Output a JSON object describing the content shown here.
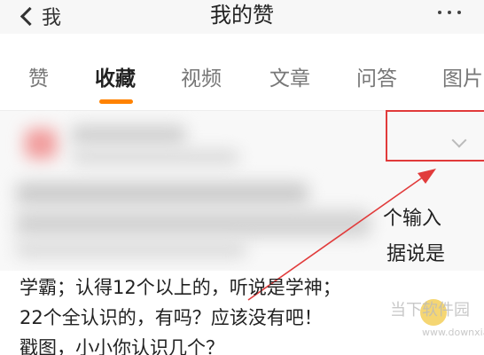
{
  "header": {
    "back_label": "我",
    "title": "我的赞"
  },
  "tabs": [
    {
      "label": "赞",
      "active": false
    },
    {
      "label": "收藏",
      "active": true
    },
    {
      "label": "视频",
      "active": false
    },
    {
      "label": "文章",
      "active": false
    },
    {
      "label": "问答",
      "active": false
    },
    {
      "label": "图片",
      "active": false
    }
  ],
  "annotation": {
    "line1": "个输入",
    "line2": "据说是"
  },
  "post": {
    "line1": "学霸；认得12个以上的，听说是学神；",
    "line2": "22个全认识的，有吗？应该没有吧！",
    "line3": "戳图，小小你认识几个？"
  },
  "watermark": {
    "title": "当下软件园",
    "url": "www.downxia.com"
  },
  "colors": {
    "accent": "#ff8200",
    "highlight_box": "#e13b3b"
  },
  "icons": [
    "chevron-left-icon",
    "more-dots-icon",
    "chevron-down-icon",
    "annotation-arrow-icon"
  ]
}
